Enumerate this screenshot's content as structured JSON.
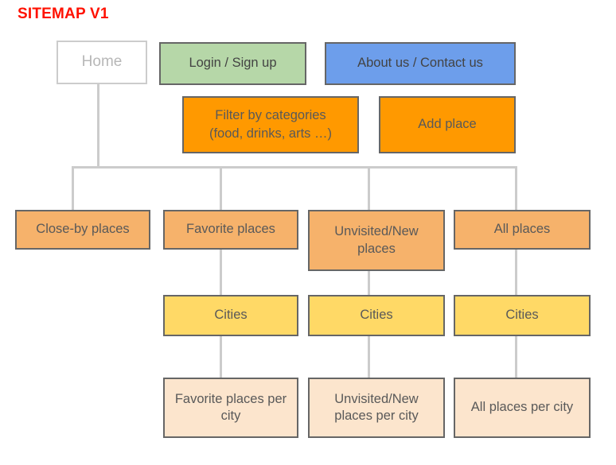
{
  "diagram": {
    "title": "SITEMAP V1",
    "title_color": "#ff1100",
    "background": "#ffffff",
    "connector_color": "#cccccc",
    "palette": {
      "home_fill": "#ffffff",
      "home_border": "#cccccc",
      "home_text": "#b7b7b7",
      "green": "#b6d7a8",
      "blue": "#6d9eeb",
      "orange": "#ff9900",
      "salmon": "#f6b26b",
      "yellow": "#ffd966",
      "cream": "#fce5cd",
      "node_border": "#666666",
      "node_text": "#595959"
    }
  },
  "nodes": {
    "home": "Home",
    "login_signup": "Login / Sign up",
    "about_contact": "About us / Contact us",
    "filter_categories": "Filter by categories\n(food, drinks, arts …)",
    "filter_categories_line1": "Filter by categories",
    "filter_categories_line2": "(food, drinks, arts …)",
    "add_place": "Add place",
    "close_by_places": "Close-by places",
    "favorite_places": "Favorite places",
    "unvisited_new_places": "Unvisited/New places",
    "all_places": "All places",
    "cities_favorite": "Cities",
    "cities_unvisited": "Cities",
    "cities_all": "Cities",
    "favorite_places_per_city": "Favorite places per city",
    "unvisited_new_places_per_city": "Unvisited/New places per city",
    "all_places_per_city": "All places per city"
  }
}
